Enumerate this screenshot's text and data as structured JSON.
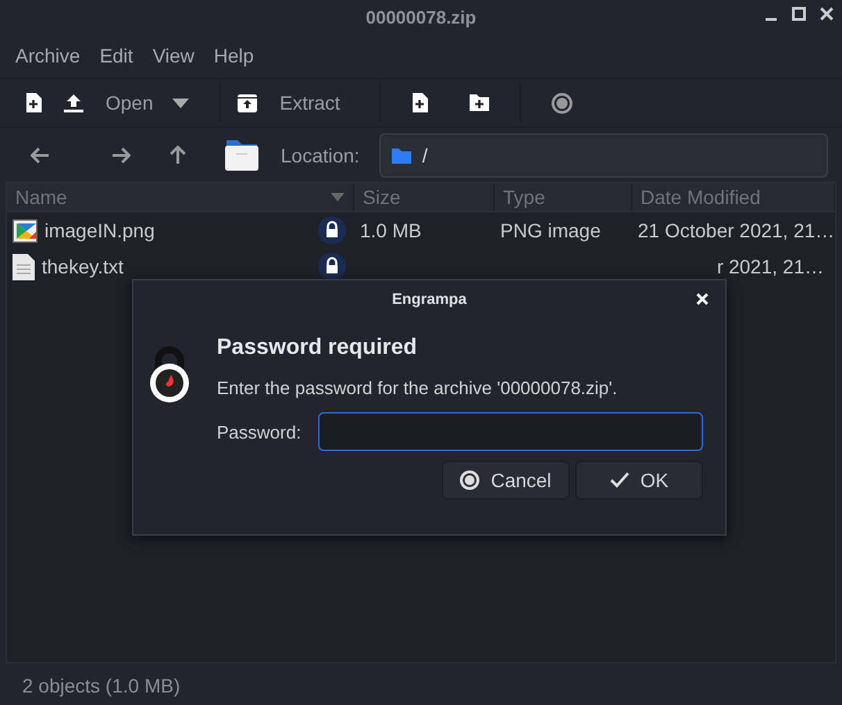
{
  "window": {
    "title": "00000078.zip"
  },
  "menu": [
    "Archive",
    "Edit",
    "View",
    "Help"
  ],
  "toolbar": {
    "open": "Open",
    "extract": "Extract"
  },
  "location": {
    "label": "Location:",
    "value": "/"
  },
  "table": {
    "columns": [
      "Name",
      "Size",
      "Type",
      "Date Modified"
    ],
    "rows": [
      {
        "kind": "image",
        "name": "imageIN.png",
        "locked": true,
        "size": "1.0 MB",
        "type": "PNG image",
        "date": "21 October 2021, 21…"
      },
      {
        "kind": "text",
        "name": "thekey.txt",
        "locked": true,
        "size": "",
        "type": "",
        "date": "r 2021, 21…"
      }
    ]
  },
  "dialog": {
    "title": "Engrampa",
    "heading": "Password required",
    "message": "Enter the password for the archive '00000078.zip'.",
    "field_label": "Password:",
    "cancel": "Cancel",
    "ok": "OK"
  },
  "status_bar": "2 objects (1.0 MB)"
}
